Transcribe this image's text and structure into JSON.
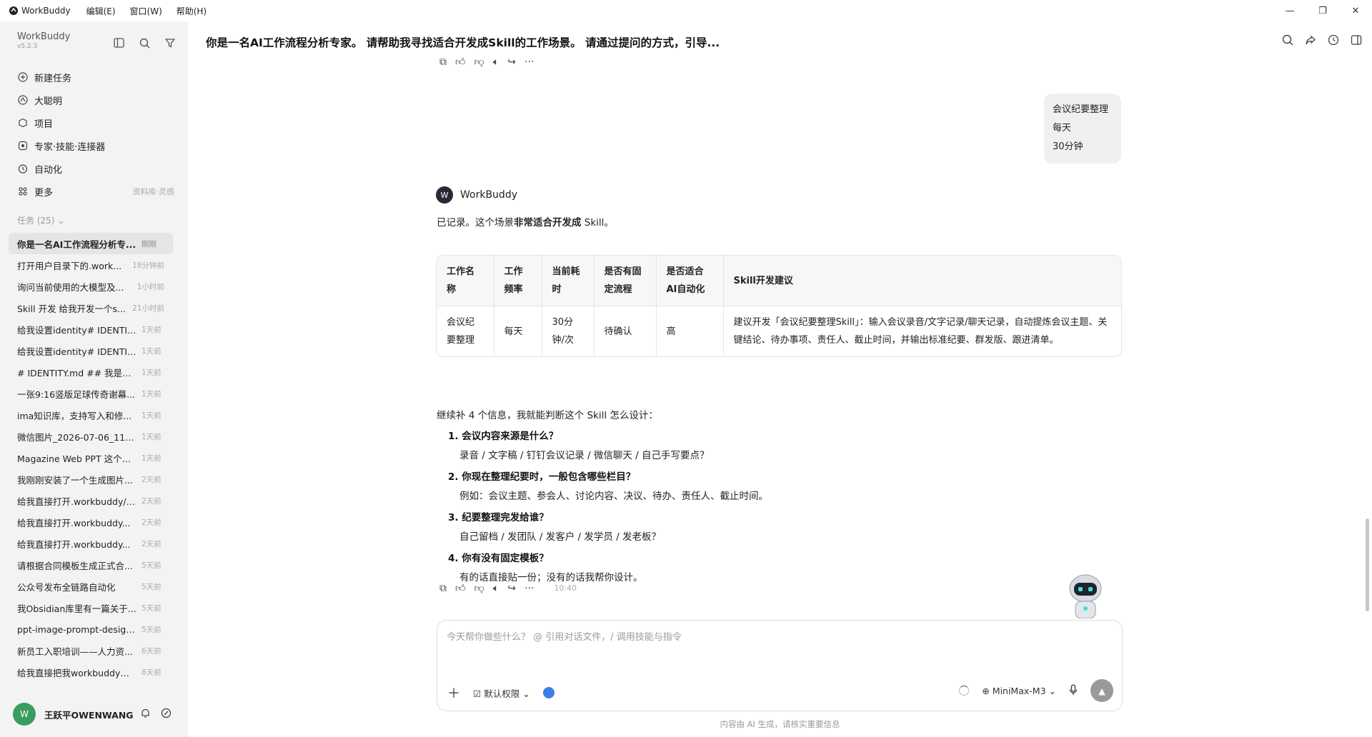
{
  "titlebar": {
    "app_name": "WorkBuddy",
    "menus": [
      "编辑(E)",
      "窗口(W)",
      "帮助(H)"
    ],
    "min": "—",
    "max": "❐",
    "close": "✕"
  },
  "sidebar": {
    "brand": "WorkBuddy",
    "version": "v5.2.3",
    "nav": [
      {
        "label": "新建任务",
        "icon": "plus-circle-icon"
      },
      {
        "label": "大聪明",
        "icon": "agent-icon"
      },
      {
        "label": "项目",
        "icon": "project-icon"
      },
      {
        "label": "专家·技能·连接器",
        "icon": "expert-icon"
      },
      {
        "label": "自动化",
        "icon": "clock-icon"
      },
      {
        "label": "更多",
        "icon": "grid-icon",
        "hint": "资料库·灵感"
      }
    ],
    "tasks_header": "任务 (25)",
    "tasks": [
      {
        "title": "你是一名AI工作流程分析专...",
        "time": "刚刚"
      },
      {
        "title": "打开用户目录下的.work...",
        "time": "18分钟前"
      },
      {
        "title": "询问当前使用的大模型及...",
        "time": "1小时前"
      },
      {
        "title": "Skill 开发 给我开发一个s...",
        "time": "21小时前"
      },
      {
        "title": "给我设置identity# IDENTIT...",
        "time": "1天前"
      },
      {
        "title": "给我设置identity# IDENTIT...",
        "time": "1天前"
      },
      {
        "title": "# IDENTITY.md ## 我是谁 ...",
        "time": "1天前"
      },
      {
        "title": "一张9:16竖版足球传奇谢幕...",
        "time": "1天前"
      },
      {
        "title": "ima知识库，支持写入和修...",
        "time": "1天前"
      },
      {
        "title": "微信图片_2026-07-06_1143...",
        "time": "1天前"
      },
      {
        "title": "Magazine Web PPT 这个技...",
        "time": "1天前"
      },
      {
        "title": "我刚刚安装了一个生成图片...",
        "time": "2天前"
      },
      {
        "title": "给我直接打开.workbuddy/s...",
        "time": "2天前"
      },
      {
        "title": "给我直接打开.workbuddy...",
        "time": "2天前"
      },
      {
        "title": "给我直接打开.workbuddy...",
        "time": "2天前"
      },
      {
        "title": "请根据合同模板生成正式合...",
        "time": "5天前"
      },
      {
        "title": "公众号发布全链路自动化",
        "time": "5天前"
      },
      {
        "title": "我Obsidian库里有一篇关于...",
        "time": "5天前"
      },
      {
        "title": "ppt-image-prompt-design...",
        "time": "5天前"
      },
      {
        "title": "新员工入职培训——人力资...",
        "time": "6天前"
      },
      {
        "title": "给我直接把我workbuddy的...",
        "time": "8天前"
      }
    ],
    "user": {
      "name": "王跃平OWENWANG",
      "avatar": "W"
    }
  },
  "chat": {
    "title": "你是一名AI工作流程分析专家。 请帮助我寻找适合开发成Skill的工作场景。 请通过提问的方式，引导...",
    "user_message": [
      "会议纪要整理",
      "每天",
      "30分钟"
    ],
    "bot_name": "WorkBuddy",
    "bot_intro_pre": "已记录。这个场景",
    "bot_intro_bold": "非常适合开发成",
    "bot_intro_post": " Skill。",
    "table": {
      "headers": [
        "工作名称",
        "工作频率",
        "当前耗时",
        "是否有固定流程",
        "是否适合AI自动化",
        "Skill开发建议"
      ],
      "rows": [
        [
          "会议纪要整理",
          "每天",
          "30分钟/次",
          "待确认",
          "高",
          "建议开发「会议纪要整理Skill」：输入会议录音/文字记录/聊天记录，自动提炼会议主题、关键结论、待办事项、责任人、截止时间，并输出标准纪要、群发版、跟进清单。"
        ]
      ]
    },
    "followup": "继续补 4 个信息，我就能判断这个 Skill 怎么设计：",
    "questions": [
      {
        "q": "1. 会议内容来源是什么？",
        "d": "录音 / 文字稿 / 钉钉会议记录 / 微信聊天 / 自己手写要点？"
      },
      {
        "q": "2. 你现在整理纪要时，一般包含哪些栏目？",
        "d": "例如：会议主题、参会人、讨论内容、决议、待办、责任人、截止时间。"
      },
      {
        "q": "3. 纪要整理完发给谁？",
        "d": "自己留档 / 发团队 / 发客户 / 发学员 / 发老板？"
      },
      {
        "q": "4. 你有没有固定模板？",
        "d": "有的话直接贴一份；没有的话我帮你设计。"
      }
    ],
    "message_time": "10:40"
  },
  "composer": {
    "placeholder": "今天帮你做些什么？ @ 引用对话文件，/ 调用技能与指令",
    "permission": "默认权限",
    "model": "MiniMax-M3"
  },
  "disclaimer": "内容由 AI 生成，请核实重要信息",
  "colors": {
    "sidebar_bg": "#f3f3f3",
    "active_task": "#e5e5e5",
    "send_button": "#9a9a9a",
    "avatar": "#3a9d5d"
  }
}
